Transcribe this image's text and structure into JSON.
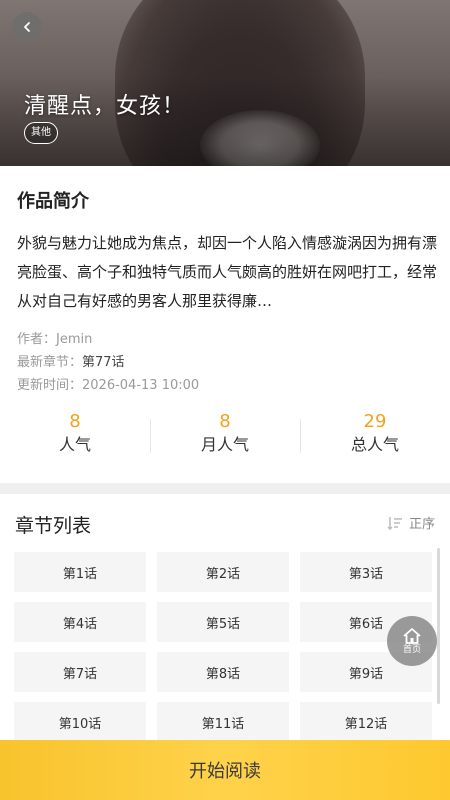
{
  "hero": {
    "title": "清醒点，女孩！",
    "tag": "其他"
  },
  "intro": {
    "section_title": "作品简介",
    "description": "外貌与魅力让她成为焦点，却因一个人陷入情感漩涡因为拥有漂亮脸蛋、高个子和独特气质而人气颇高的胜妍在网吧打工，经常从对自己有好感的男客人那里获得廉…",
    "author_label": "作者：",
    "author": "Jemin",
    "latest_label": "最新章节：",
    "latest": "第77话",
    "updated_label": "更新时间：",
    "updated": "2026-04-13 10:00"
  },
  "stats": [
    {
      "value": "8",
      "label": "人气"
    },
    {
      "value": "8",
      "label": "月人气"
    },
    {
      "value": "29",
      "label": "总人气"
    }
  ],
  "chapters": {
    "title": "章节列表",
    "sort_label": "正序",
    "items": [
      "第1话",
      "第2话",
      "第3话",
      "第4话",
      "第5话",
      "第6话",
      "第7话",
      "第8话",
      "第9话",
      "第10话",
      "第11话",
      "第12话"
    ]
  },
  "home_button": {
    "label": "首页"
  },
  "read_button": {
    "label": "开始阅读"
  },
  "colors": {
    "accent": "#f3a21e",
    "read_button": "#ffd24a"
  },
  "icons": {
    "back": "chevron-left-icon",
    "sort": "sort-list-icon",
    "home": "home-icon"
  }
}
